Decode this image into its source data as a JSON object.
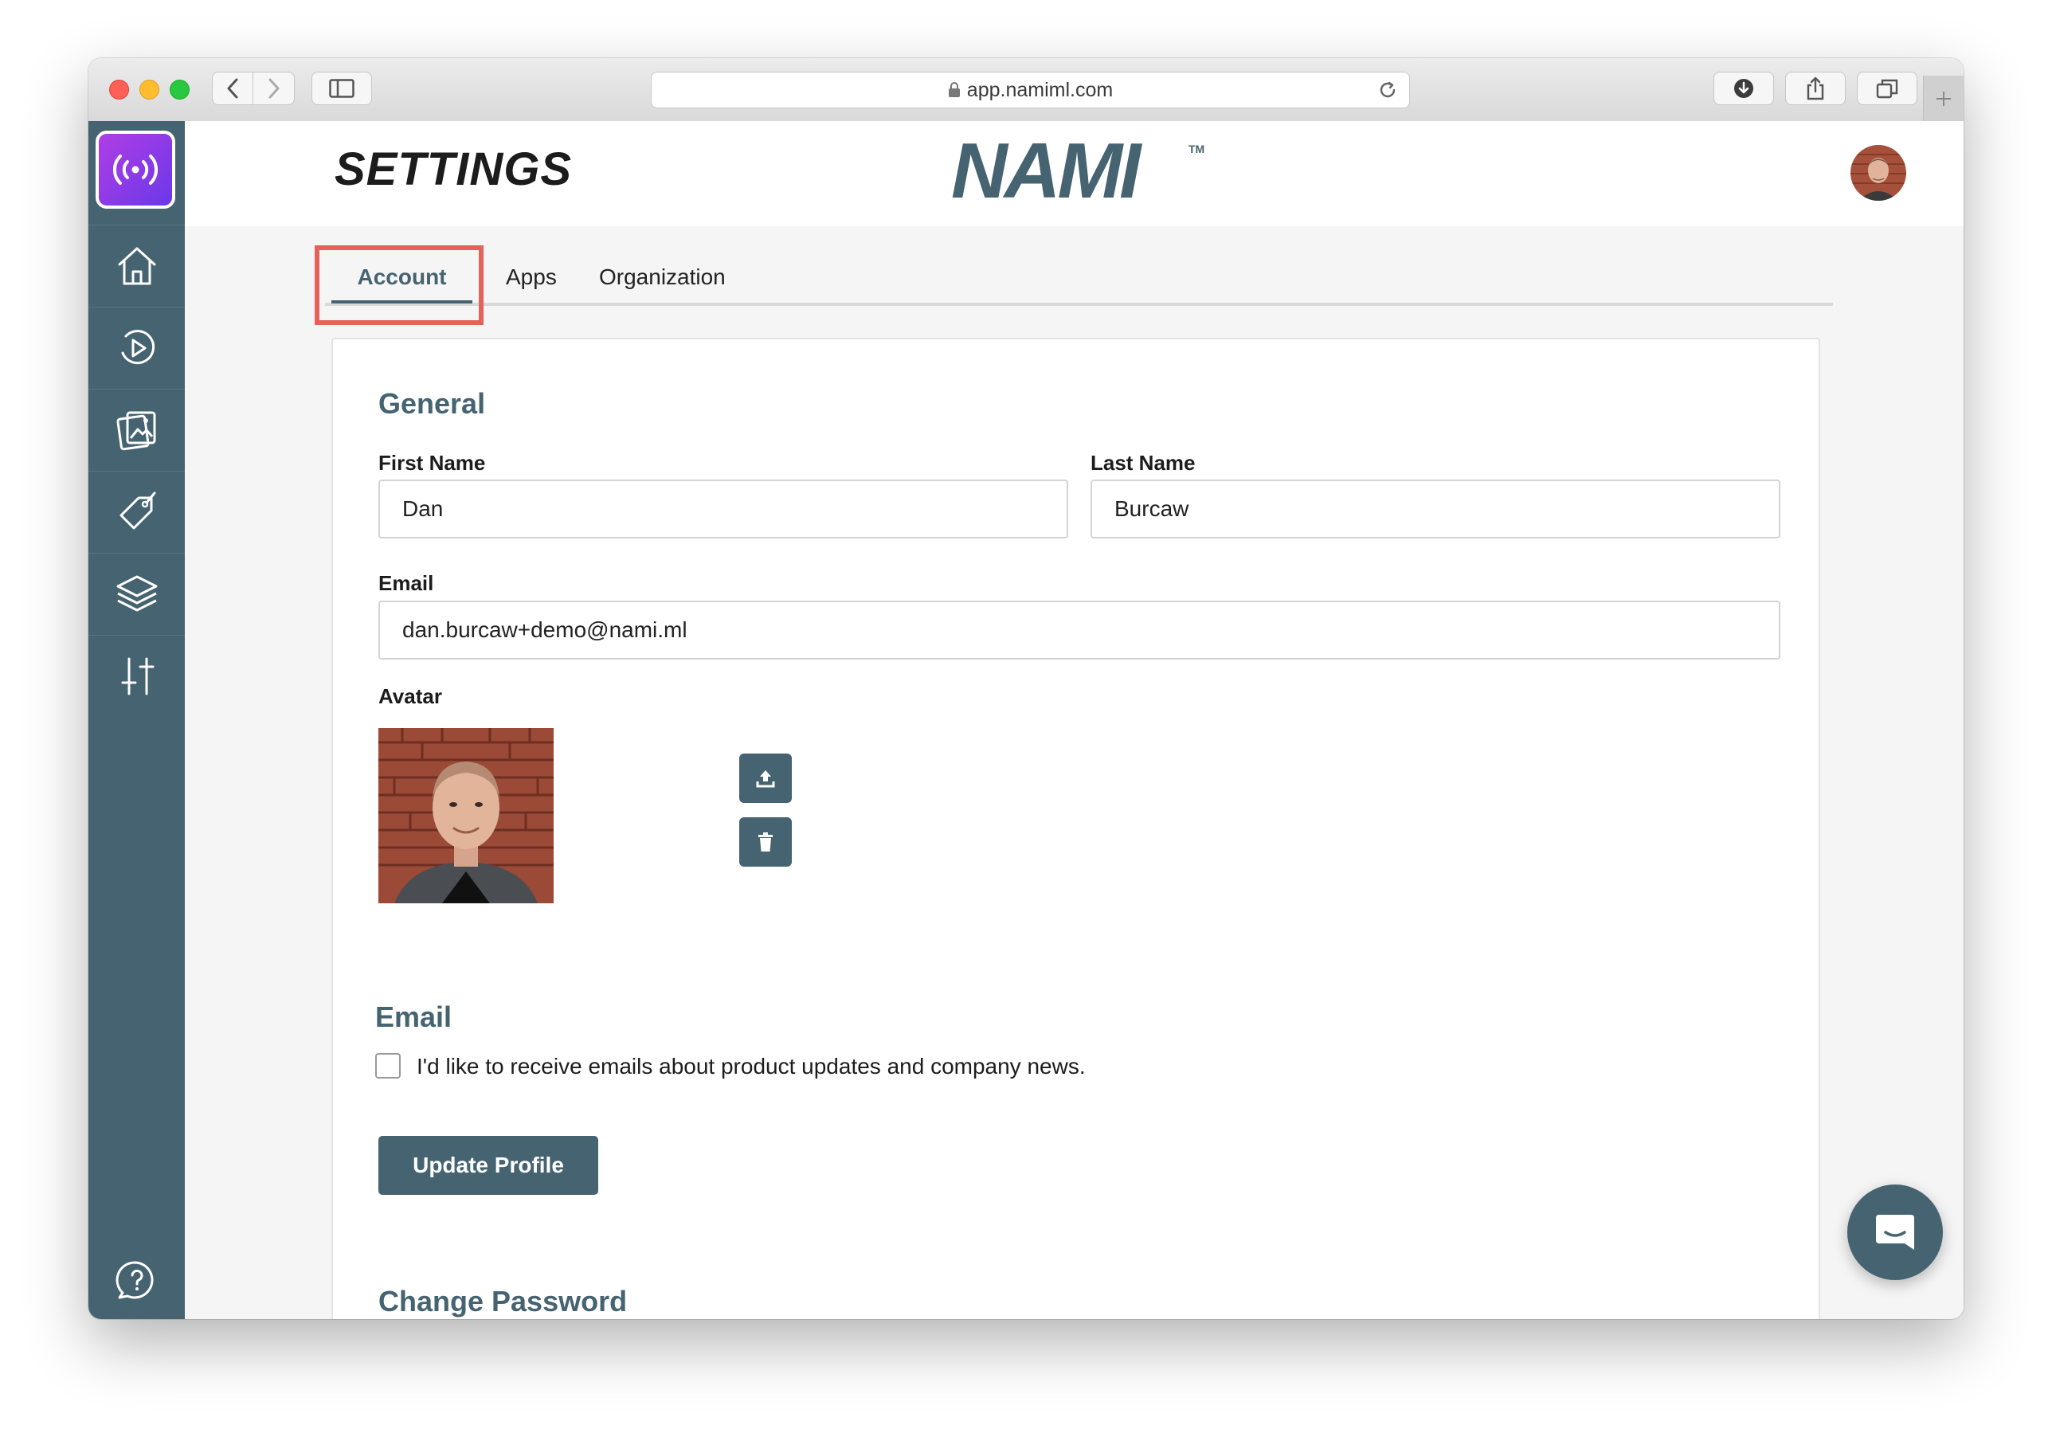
{
  "browser": {
    "url": "app.namiml.com",
    "icons": {
      "back": "chevron-left-icon",
      "forward": "chevron-right-icon",
      "sidebar": "sidebar-icon",
      "lock": "lock-icon",
      "reload": "reload-icon",
      "download": "download-icon",
      "share": "share-icon",
      "tabs": "tabs-icon",
      "new_tab": "plus-icon"
    }
  },
  "sidebar": {
    "items": [
      {
        "name": "home",
        "icon": "home-icon"
      },
      {
        "name": "campaigns",
        "icon": "play-circle-icon"
      },
      {
        "name": "paywalls",
        "icon": "image-gallery-icon"
      },
      {
        "name": "products",
        "icon": "tag-icon"
      },
      {
        "name": "entitlements",
        "icon": "layers-icon"
      },
      {
        "name": "settings",
        "icon": "sliders-icon"
      }
    ],
    "help_icon": "help-icon"
  },
  "header": {
    "title": "SETTINGS",
    "brand": "NAMI",
    "brand_mark": "TM"
  },
  "tabs": [
    {
      "label": "Account",
      "active": true
    },
    {
      "label": "Apps",
      "active": false
    },
    {
      "label": "Organization",
      "active": false
    }
  ],
  "general": {
    "title": "General",
    "first_name_label": "First Name",
    "first_name_value": "Dan",
    "last_name_label": "Last Name",
    "last_name_value": "Burcaw",
    "email_label": "Email",
    "email_value": "dan.burcaw+demo@nami.ml",
    "avatar_label": "Avatar",
    "upload_icon": "upload-icon",
    "delete_icon": "trash-icon"
  },
  "email_section": {
    "title": "Email",
    "checkbox_label": "I'd like to receive emails about product updates and company news.",
    "checked": false
  },
  "update_button": "Update Profile",
  "password_section": {
    "title": "Change Password"
  },
  "colors": {
    "primary": "#456370",
    "highlight": "#e5625a",
    "logo_gradient_start": "#b03ee6",
    "logo_gradient_end": "#6a38e8"
  }
}
